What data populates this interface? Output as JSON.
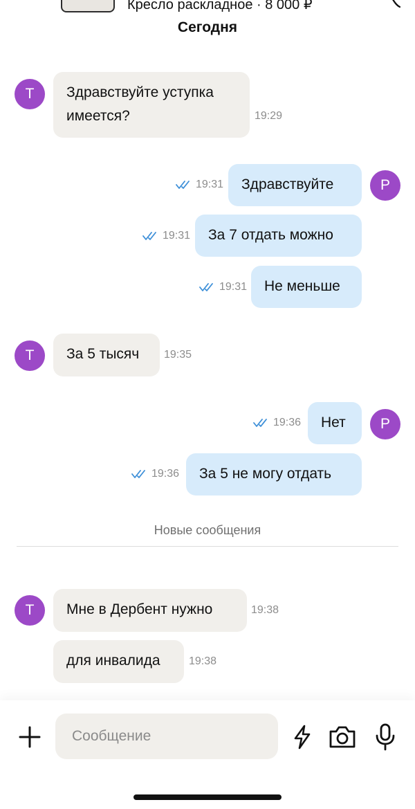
{
  "listing": {
    "title": "Кресло раскладное · 8 000 ₽"
  },
  "date_label": "Сегодня",
  "avatars": {
    "other": "Т",
    "me": "Р"
  },
  "messages": [
    {
      "side": "in",
      "text": "Здравствуйте уступка имеется?",
      "time": "19:29"
    },
    {
      "side": "out",
      "text": "Здравствуйте",
      "time": "19:31",
      "read": true
    },
    {
      "side": "out",
      "text": "За 7 отдать можно",
      "time": "19:31",
      "read": true
    },
    {
      "side": "out",
      "text": "Не меньше",
      "time": "19:31",
      "read": true
    },
    {
      "side": "in",
      "text": "За 5 тысяч",
      "time": "19:35"
    },
    {
      "side": "out",
      "text": "Нет",
      "time": "19:36",
      "read": true
    },
    {
      "side": "out",
      "text": "За 5 не могу отдать",
      "time": "19:36",
      "read": true
    },
    {
      "side": "in",
      "text": "Мне в Дербент нужно",
      "time": "19:38"
    },
    {
      "side": "in",
      "text": "для инвалида",
      "time": "19:38"
    }
  ],
  "new_messages_label": "Новые сообщения",
  "composer": {
    "placeholder": "Сообщение",
    "attach_icon": "plus-icon",
    "quick_reply_icon": "lightning-icon",
    "camera_icon": "camera-icon",
    "mic_icon": "microphone-icon"
  },
  "colors": {
    "avatar": "#9c49c7",
    "incoming_bubble": "#f1efeb",
    "outgoing_bubble": "#d7ebfb",
    "read_check": "#3d8fd8"
  }
}
